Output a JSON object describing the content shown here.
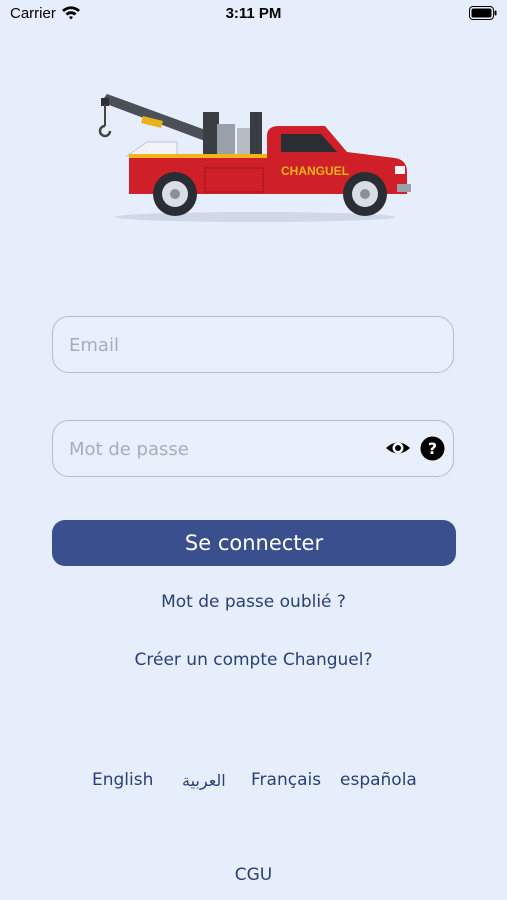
{
  "status_bar": {
    "carrier": "Carrier",
    "time": "3:11 PM"
  },
  "hero": {
    "truck_brand": "CHANGUEL"
  },
  "login_form": {
    "email_placeholder": "Email",
    "password_placeholder": "Mot de passe",
    "submit_label": "Se connecter"
  },
  "links": {
    "forgot_password": "Mot de passe oublié ?",
    "create_account": "Créer un compte Changuel?",
    "terms": "CGU"
  },
  "languages": [
    "English",
    "العربية",
    "Français",
    "española"
  ],
  "colors": {
    "background": "#e6eefb",
    "primary": "#3a4f8e",
    "text": "#2c3e7a",
    "truck_red": "#cf1f28"
  },
  "icons": [
    "wifi-icon",
    "battery-icon",
    "eye-icon",
    "help-icon"
  ]
}
